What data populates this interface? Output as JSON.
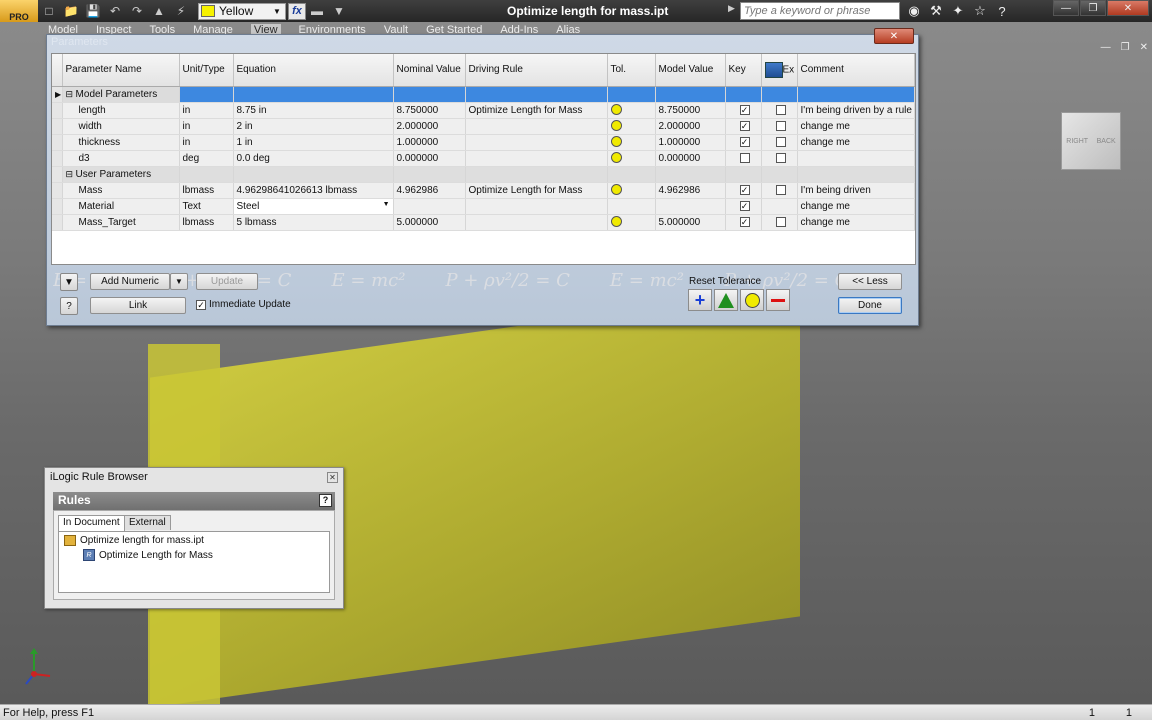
{
  "app": {
    "document_title": "Optimize length for mass.ipt",
    "color_override": "Yellow",
    "search_placeholder": "Type a keyword or phrase",
    "app_badge": "PRO"
  },
  "ribbon": {
    "tabs": [
      "Model",
      "Inspect",
      "Tools",
      "Manage",
      "View",
      "Environments",
      "Vault",
      "Get Started",
      "Add-Ins",
      "Alias"
    ]
  },
  "parameters_dialog": {
    "title": "Parameters",
    "columns": [
      "Parameter Name",
      "Unit/Type",
      "Equation",
      "Nominal Value",
      "Driving Rule",
      "Tol.",
      "Model Value",
      "Key",
      "Ex",
      "Comment"
    ],
    "groups": [
      {
        "label": "Model Parameters",
        "rows": [
          {
            "name": "length",
            "unit": "in",
            "equation": "8.75 in",
            "nominal": "8.750000",
            "rule": "Optimize Length for Mass",
            "tol": "yellow",
            "model": "8.750000",
            "key": true,
            "export": false,
            "comment": "I'm being driven by a rule"
          },
          {
            "name": "width",
            "unit": "in",
            "equation": "2 in",
            "nominal": "2.000000",
            "rule": "",
            "tol": "yellow",
            "model": "2.000000",
            "key": true,
            "export": false,
            "comment": "change me"
          },
          {
            "name": "thickness",
            "unit": "in",
            "equation": "1 in",
            "nominal": "1.000000",
            "rule": "",
            "tol": "yellow",
            "model": "1.000000",
            "key": true,
            "export": false,
            "comment": "change me"
          },
          {
            "name": "d3",
            "unit": "deg",
            "equation": "0.0 deg",
            "nominal": "0.000000",
            "rule": "",
            "tol": "yellow",
            "model": "0.000000",
            "key": false,
            "export": false,
            "comment": ""
          }
        ]
      },
      {
        "label": "User Parameters",
        "rows": [
          {
            "name": "Mass",
            "unit": "lbmass",
            "equation": "4.96298641026613 lbmass",
            "nominal": "4.962986",
            "rule": "Optimize Length for Mass",
            "tol": "yellow",
            "model": "4.962986",
            "key": true,
            "export": false,
            "comment": "I'm being driven"
          },
          {
            "name": "Material",
            "unit": "Text",
            "equation": "Steel",
            "nominal": "",
            "rule": "",
            "tol": "",
            "model": "",
            "key": true,
            "export": null,
            "comment": "change me"
          },
          {
            "name": "Mass_Target",
            "unit": "lbmass",
            "equation": "5 lbmass",
            "nominal": "5.000000",
            "rule": "",
            "tol": "yellow",
            "model": "5.000000",
            "key": true,
            "export": false,
            "comment": "change me"
          }
        ]
      }
    ],
    "watermark": [
      "E = mc²",
      "P + ρv²/2 = C",
      "E = mc²",
      "P + ρv²/2 = C",
      "E = mc²",
      "P + ρv²/2 = C"
    ],
    "buttons": {
      "add_numeric": "Add Numeric",
      "update": "Update",
      "link": "Link",
      "immediate_update": "Immediate Update",
      "reset_tolerance": "Reset Tolerance",
      "less": "<< Less",
      "done": "Done"
    },
    "immediate_update_checked": true,
    "tol_color": "#f0ea00",
    "selection_color": "#3d88e0"
  },
  "ilogic_browser": {
    "title": "iLogic Rule Browser",
    "section": "Rules",
    "tabs": [
      "In Document",
      "External"
    ],
    "tree": {
      "document": "Optimize length for mass.ipt",
      "rule": "Optimize Length for Mass"
    }
  },
  "viewcube": {
    "faces": [
      "RIGHT",
      "BACK"
    ]
  },
  "status": {
    "help": "For Help, press F1",
    "count1": "1",
    "count2": "1"
  }
}
